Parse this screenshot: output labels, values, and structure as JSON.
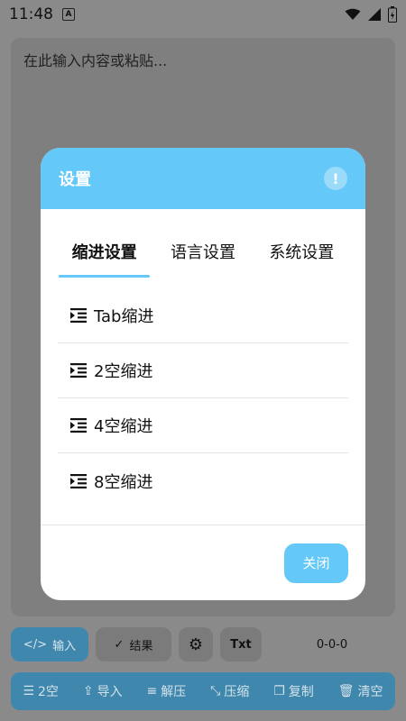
{
  "status_bar": {
    "time": "11:48",
    "notif_badge": "A"
  },
  "editor": {
    "placeholder": "在此输入内容或粘贴..."
  },
  "toolbar": {
    "input_label": "输入",
    "result_label": "结果",
    "txt_label": "Txt",
    "counter": "0-0-0"
  },
  "bottom_bar": {
    "items": [
      {
        "label": "2空",
        "icon": "indent-icon"
      },
      {
        "label": "导入",
        "icon": "import-icon"
      },
      {
        "label": "解压",
        "icon": "decompress-icon"
      },
      {
        "label": "压缩",
        "icon": "compress-icon"
      },
      {
        "label": "复制",
        "icon": "copy-icon"
      },
      {
        "label": "清空",
        "icon": "trash-icon"
      }
    ]
  },
  "dialog": {
    "title": "设置",
    "tabs": [
      "缩进设置",
      "语言设置",
      "系统设置"
    ],
    "active_tab": 0,
    "options": [
      "Tab缩进",
      "2空缩进",
      "4空缩进",
      "8空缩进"
    ],
    "close_label": "关闭"
  },
  "colors": {
    "accent": "#64c8f8",
    "accent_dim": "#3f87ad",
    "backdrop": "#8a8a8a"
  }
}
